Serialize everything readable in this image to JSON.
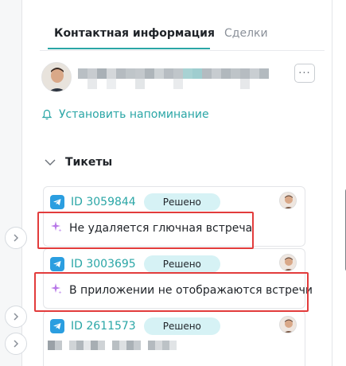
{
  "tabs": [
    {
      "label": "Контактная информация",
      "active": true
    },
    {
      "label": "Сделки",
      "active": false
    }
  ],
  "contact": {
    "more_label": "···"
  },
  "reminder": {
    "label": "Установить напоминание",
    "icon": "bell-icon"
  },
  "tickets": {
    "title": "Тикеты",
    "items": [
      {
        "id": "ID 3059844",
        "status": "Решено",
        "subject": "Не удаляется глючная встреча",
        "channel_icon": "telegram-icon",
        "subject_icon": "sparkle-icon"
      },
      {
        "id": "ID 3003695",
        "status": "Решено",
        "subject": "В приложении не отображаются встречи",
        "channel_icon": "telegram-icon",
        "subject_icon": "sparkle-icon"
      },
      {
        "id": "ID 2611573",
        "status": "Решено",
        "subject": "",
        "channel_icon": "telegram-icon",
        "subject_icon": ""
      }
    ]
  },
  "colors": {
    "accent": "#2aa6a6",
    "status_bg": "#d6f2f5",
    "telegram": "#2b9ee0",
    "highlight": "#e23c3c"
  }
}
